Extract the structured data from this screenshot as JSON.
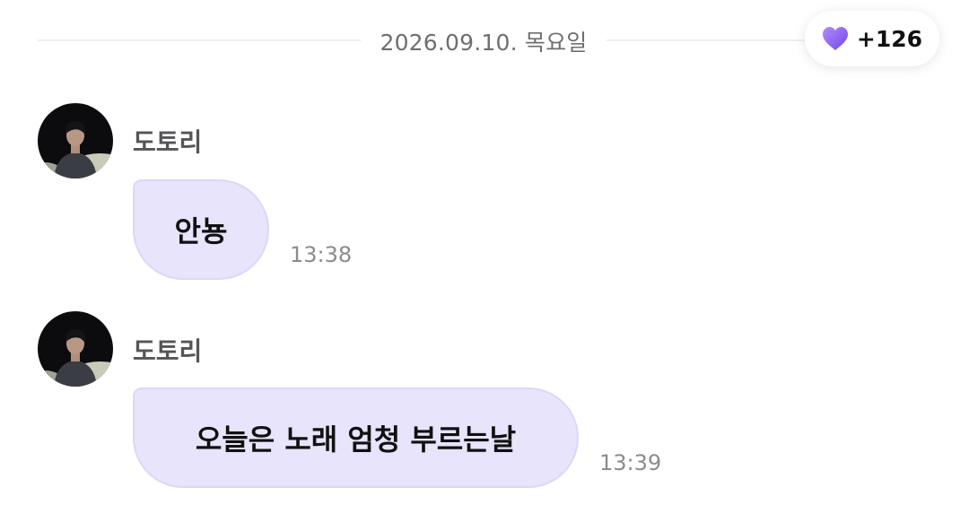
{
  "date_divider": {
    "text": "2026.09.10. 목요일"
  },
  "heart_badge": {
    "count": "+126",
    "icon": "purple-heart-icon",
    "color": "#8a63f0"
  },
  "messages": [
    {
      "sender": "도토리",
      "text": "안뇽",
      "time": "13:38"
    },
    {
      "sender": "도토리",
      "text": "오늘은 노래 엄청 부르는날",
      "time": "13:39"
    }
  ],
  "colors": {
    "bubble": "#e7e4fb",
    "bubble_border": "#dcd8f5",
    "time_text": "#8c8c90",
    "name_text": "#555558"
  }
}
